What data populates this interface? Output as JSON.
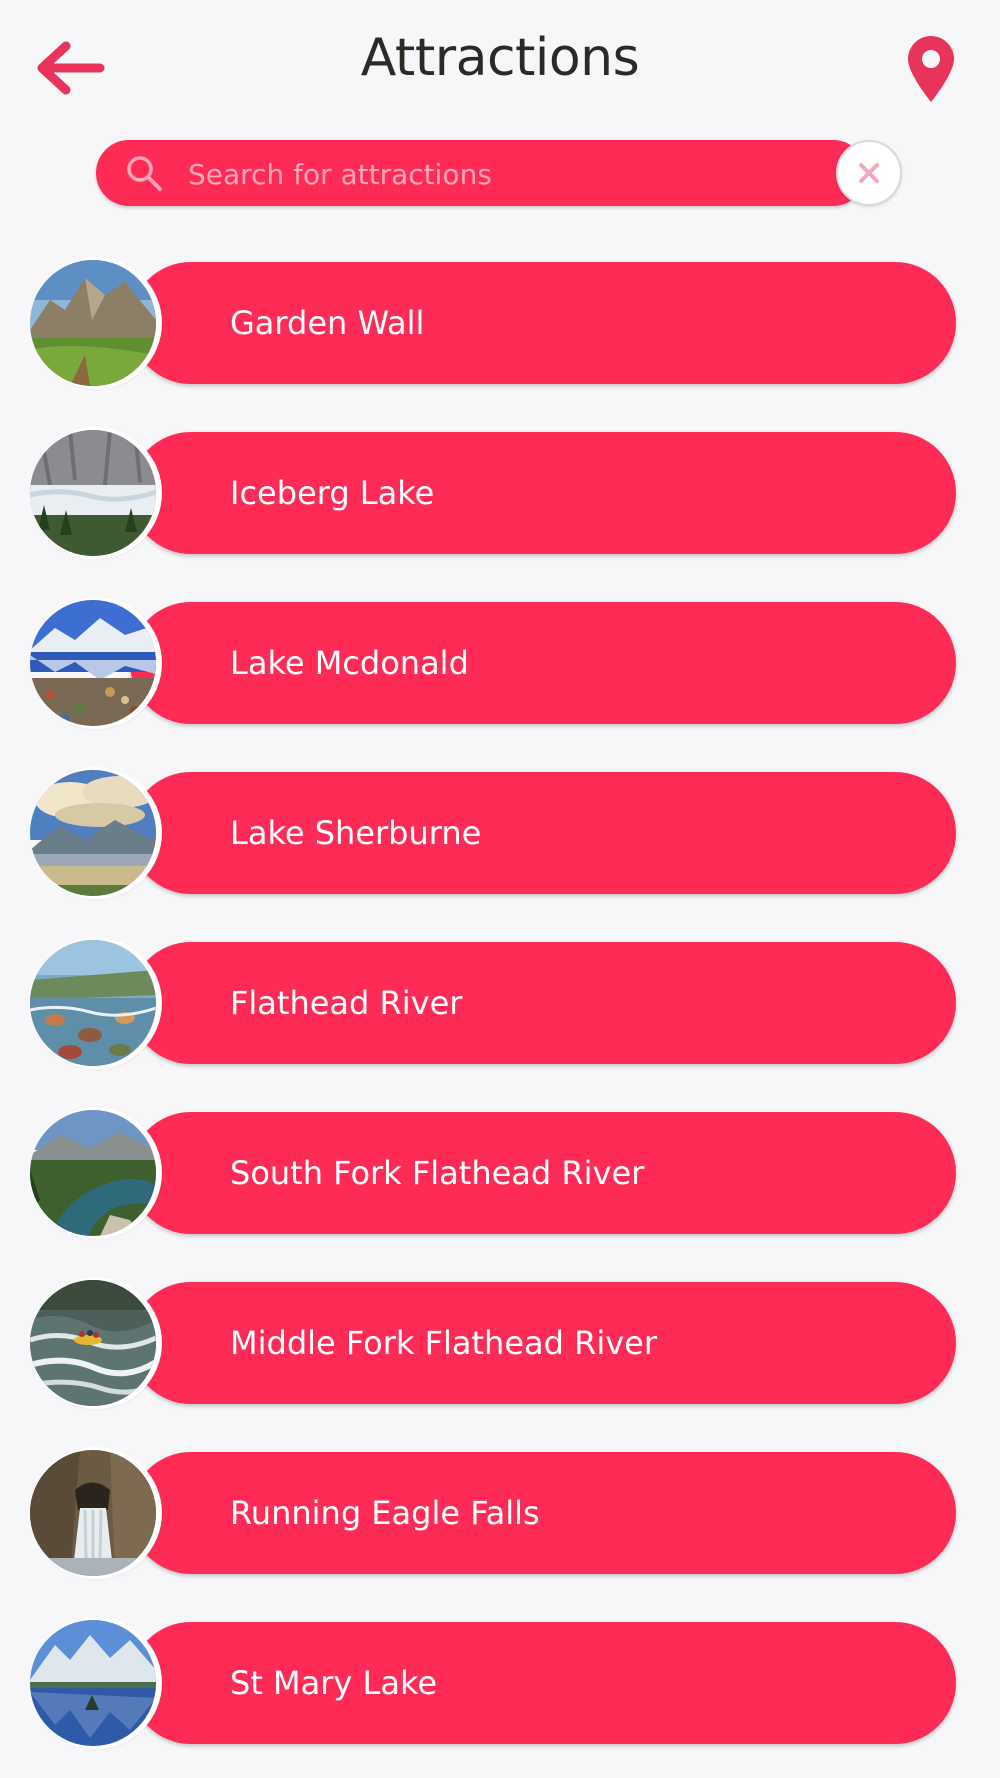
{
  "header": {
    "title": "Attractions",
    "back_icon": "arrow-left-icon",
    "location_icon": "map-pin-icon"
  },
  "search": {
    "placeholder": "Search for attractions",
    "value": "",
    "icon": "search-icon",
    "clear_icon": "close-icon"
  },
  "colors": {
    "accent": "#ff2b57",
    "background": "#f7f7f9",
    "title_text": "#2b2b26",
    "placeholder": "#ffa6b8"
  },
  "attractions": [
    {
      "label": "Garden Wall",
      "image": "mountain-meadow"
    },
    {
      "label": "Iceberg Lake",
      "image": "glacier-lake"
    },
    {
      "label": "Lake Mcdonald",
      "image": "mountain-lake-pebbles"
    },
    {
      "label": "Lake Sherburne",
      "image": "cloudy-lake"
    },
    {
      "label": "Flathead River",
      "image": "river-stones"
    },
    {
      "label": "South Fork Flathead River",
      "image": "river-valley"
    },
    {
      "label": "Middle Fork Flathead River",
      "image": "whitewater-rafting"
    },
    {
      "label": "Running Eagle Falls",
      "image": "waterfall"
    },
    {
      "label": "St Mary Lake",
      "image": "mountain-lake-island"
    }
  ]
}
